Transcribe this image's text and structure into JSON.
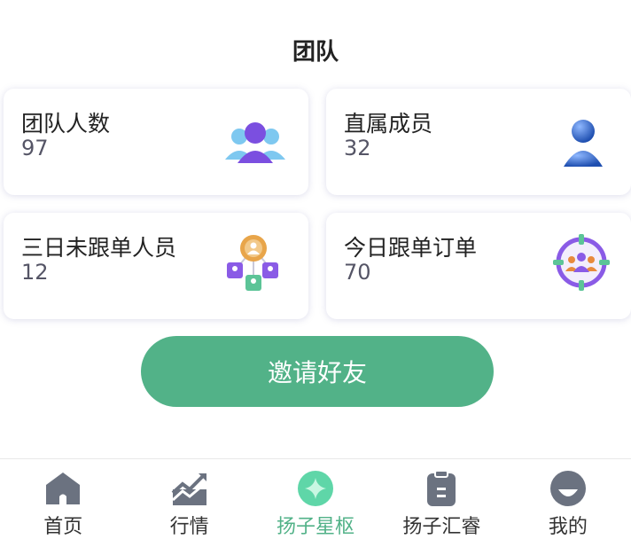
{
  "page": {
    "title": "团队"
  },
  "stats": [
    {
      "label": "团队人数",
      "value": "97",
      "icon": "team-members-icon"
    },
    {
      "label": "直属成员",
      "value": "32",
      "icon": "direct-member-icon"
    },
    {
      "label": "三日未跟单人员",
      "value": "12",
      "icon": "inactive-members-icon"
    },
    {
      "label": "今日跟单订单",
      "value": "70",
      "icon": "target-orders-icon"
    }
  ],
  "invite_button": {
    "label": "邀请好友"
  },
  "tabbar": {
    "active_index": 2,
    "active_color": "#52b288",
    "items": [
      {
        "label": "首页",
        "icon": "home-icon"
      },
      {
        "label": "行情",
        "icon": "market-chart-icon"
      },
      {
        "label": "扬子星枢",
        "icon": "star-icon"
      },
      {
        "label": "扬子汇睿",
        "icon": "clipboard-icon"
      },
      {
        "label": "我的",
        "icon": "profile-icon"
      }
    ]
  }
}
